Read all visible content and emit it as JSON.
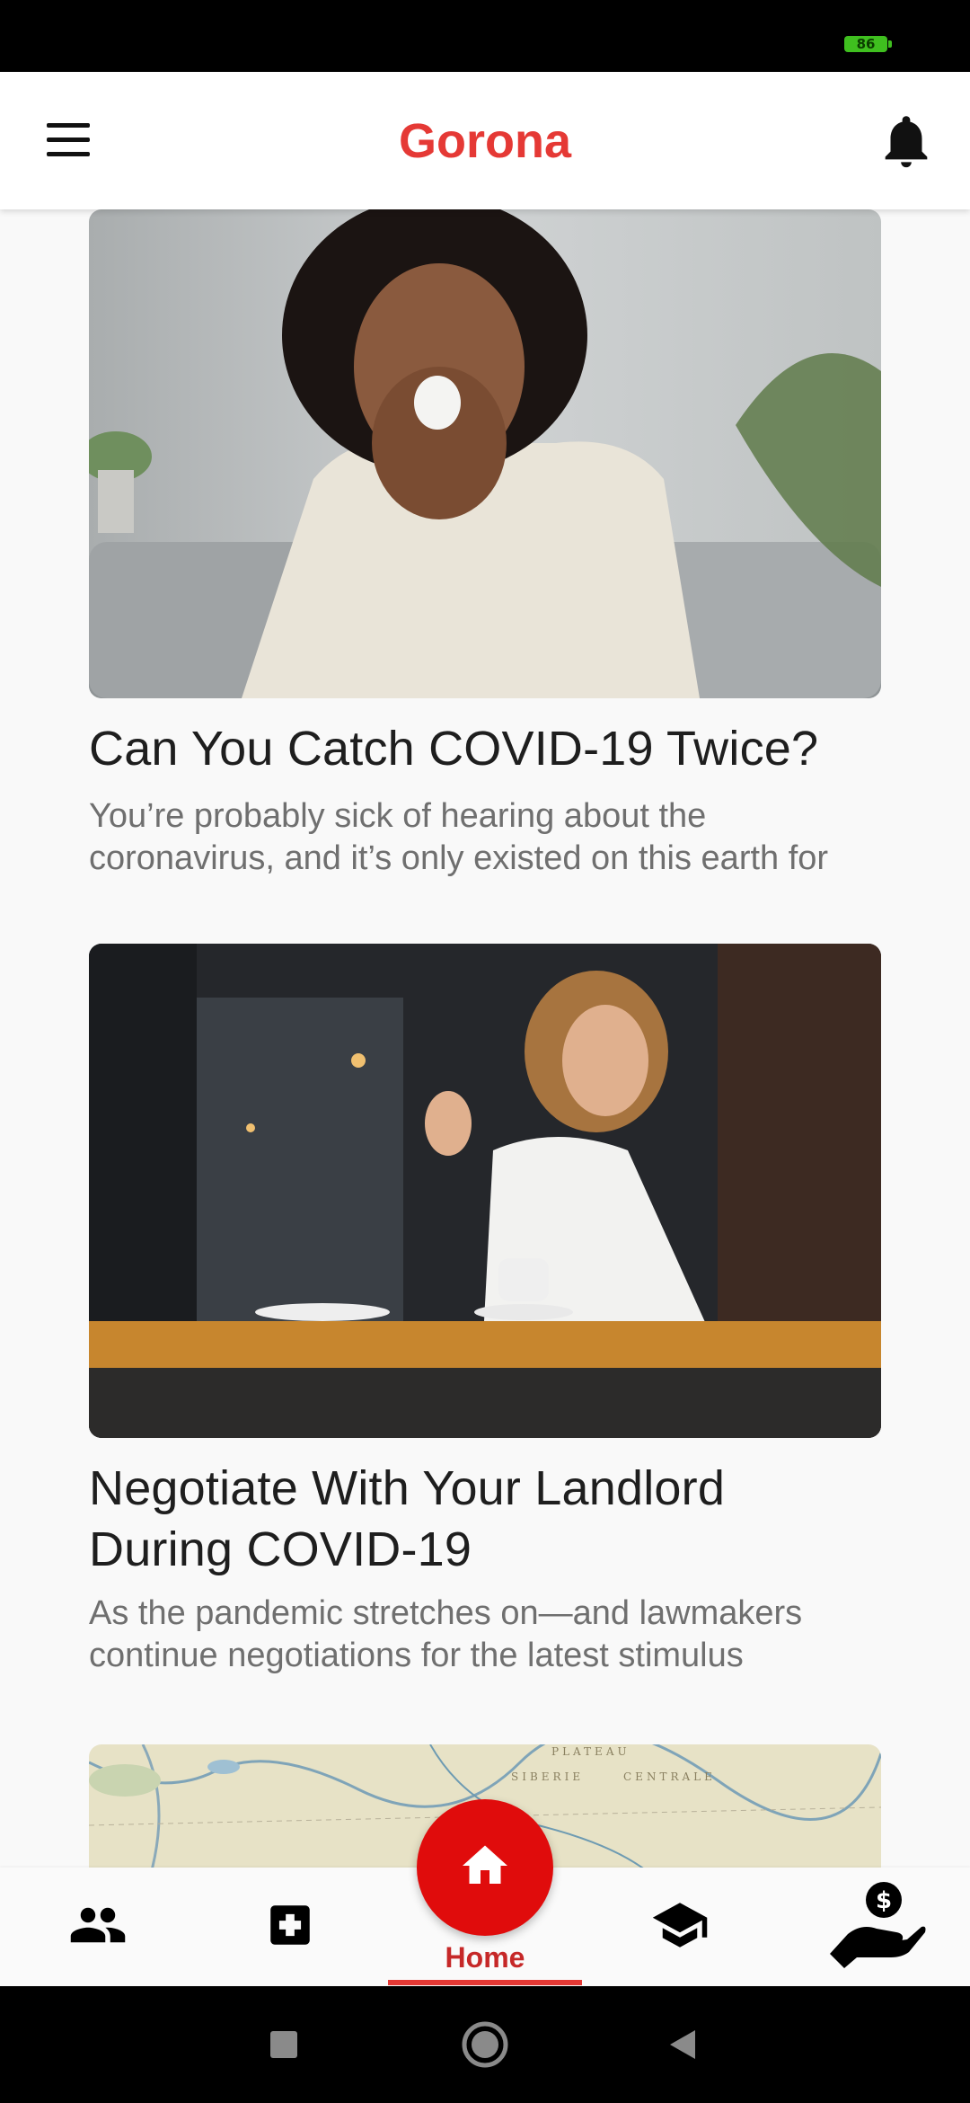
{
  "status_bar": {
    "battery_level": "86"
  },
  "app_bar": {
    "title": "Gorona",
    "title_color": "#e53935",
    "menu_icon": "hamburger-menu-icon",
    "notification_icon": "bell-icon"
  },
  "articles": [
    {
      "title": "Can You Catch COVID-19 Twice?",
      "excerpt_line1": "You’re probably sick of hearing about the",
      "excerpt_line2": "coronavirus, and it’s only existed on this earth for"
    },
    {
      "title_line1": "Negotiate With Your Landlord",
      "title_line2": "During COVID-19",
      "excerpt_line1": "As the pandemic stretches on—and lawmakers",
      "excerpt_line2": "continue negotiations for the latest stimulus"
    },
    {
      "map_labels": [
        "PLATEAU",
        "SIBERIE",
        "CENTRALE"
      ]
    }
  ],
  "bottom_nav": {
    "items": [
      {
        "icon": "people-icon"
      },
      {
        "icon": "medical-cross-icon"
      },
      {
        "icon": "home-icon",
        "label": "Home",
        "active": true
      },
      {
        "icon": "graduation-cap-icon"
      },
      {
        "icon": "money-hand-icon"
      }
    ],
    "accent_color": "#e00c0c"
  },
  "system_nav": {
    "buttons": [
      "recents-icon",
      "home-circle-icon",
      "back-icon"
    ]
  }
}
